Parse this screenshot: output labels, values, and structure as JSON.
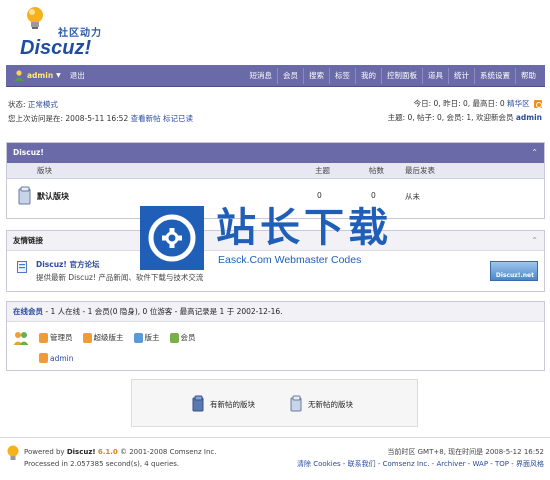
{
  "logo": {
    "cn": "社区动力",
    "en": "Discuz!"
  },
  "navbar": {
    "username": "admin",
    "logout": "退出",
    "menu": [
      "短消息",
      "会员",
      "搜索",
      "标签",
      "我的",
      "控制面板",
      "道具",
      "统计",
      "系统设置",
      "帮助"
    ]
  },
  "status": {
    "state_label": "状态:",
    "state_value": "正常模式",
    "last_visit": "您上次访问是在: 2008-5-11 16:52",
    "view_new": "查看新帖",
    "mark_read": "标记已读",
    "today_stats": "今日: 0, 昨日: 0, 最高日: 0",
    "digest": "精华区",
    "totals": "主题: 0, 帖子: 0, 会员: 1, 欢迎新会员",
    "new_member": "admin"
  },
  "forum": {
    "title": "Discuz!",
    "columns": {
      "board": "版块",
      "topics": "主题",
      "posts": "帖数",
      "last": "最后发表"
    },
    "rows": [
      {
        "name": "默认版块",
        "topics": "0",
        "posts": "0",
        "last": "从未"
      }
    ]
  },
  "links": {
    "title": "友情链接",
    "items": [
      {
        "name": "Discuz! 官方论坛",
        "desc": "提供最新 Discuz! 产品新闻、软件下载与技术交流",
        "badge": "Discuz!.net"
      }
    ]
  },
  "online": {
    "title": "在线会员",
    "summary": "- 1 人在线 - 1 会员(0 隐身), 0 位游客 - 最高记录是 1 于 2002-12-16.",
    "legend": [
      {
        "label": "管理员",
        "color": "#f09a3a"
      },
      {
        "label": "超级版主",
        "color": "#f09a3a"
      },
      {
        "label": "版主",
        "color": "#5a9ad6"
      },
      {
        "label": "会员",
        "color": "#7ab04a"
      }
    ],
    "members": [
      {
        "name": "admin",
        "color": "#f09a3a"
      }
    ]
  },
  "icon_legend": {
    "new": "有新帖的版块",
    "none": "无新帖的版块"
  },
  "footer": {
    "powered_label": "Powered by",
    "product": "Discuz!",
    "version": "6.1.0",
    "copyright": "© 2001-2008 Comsenz Inc.",
    "processed": "Processed in 2.057385 second(s), 4 queries.",
    "timezone": "当前时区 GMT+8, 现在时间是 2008-5-12 16:52",
    "links": "清除 Cookies - 联系我们 - Comsenz Inc. - Archiver - WAP - TOP - 界面风格"
  },
  "watermark": {
    "cn": "站长下载",
    "en": "Easck.Com Webmaster Codes"
  },
  "colors": {
    "nav": "#6a6aa8",
    "link": "#2a4a9c",
    "watermark": "#1f5fb8"
  }
}
